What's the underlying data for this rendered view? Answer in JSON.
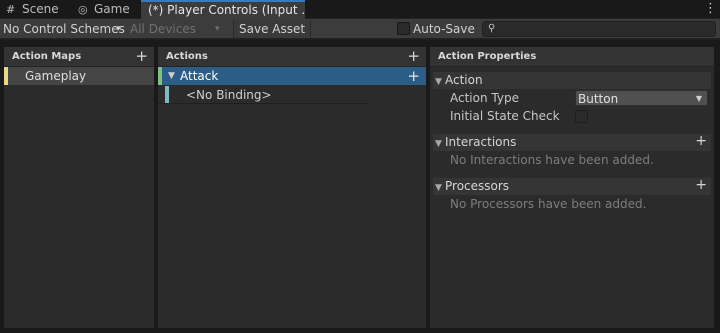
{
  "tabs": [
    {
      "icon": "grid-icon",
      "icon_glyph": "#",
      "label": "Scene"
    },
    {
      "icon": "gamepad-icon",
      "icon_glyph": "◎",
      "label": "Game"
    },
    {
      "icon": "",
      "icon_glyph": "",
      "label": "(*) Player Controls (Input ..."
    }
  ],
  "window_menu_glyph": "⋮",
  "toolbar": {
    "control_schemes_label": "No Control Schemes",
    "devices_label": "All Devices",
    "save_asset_label": "Save Asset",
    "auto_save_label": "Auto-Save",
    "auto_save_checked": false,
    "search_value": "",
    "dropdown_arrow": "▾"
  },
  "action_maps": {
    "title": "Action Maps",
    "add_glyph": "+",
    "items": [
      {
        "label": "Gameplay",
        "selected": true
      }
    ]
  },
  "actions": {
    "title": "Actions",
    "add_glyph": "+",
    "items": [
      {
        "label": "Attack",
        "expanded": true,
        "selected": true,
        "add_glyph": "+"
      }
    ],
    "bindings": [
      {
        "label": "<No Binding>"
      }
    ]
  },
  "action_properties": {
    "title": "Action Properties",
    "action_section": {
      "label": "Action",
      "fields": [
        {
          "label": "Action Type",
          "value": "Button"
        },
        {
          "label": "Initial State Check",
          "checked": false
        }
      ]
    },
    "interactions_section": {
      "label": "Interactions",
      "empty_text": "No Interactions have been added.",
      "add_glyph": "+"
    },
    "processors_section": {
      "label": "Processors",
      "empty_text": "No Processors have been added.",
      "add_glyph": "+"
    }
  },
  "colors": {
    "selection": "#2c5d87",
    "action_map_stripe": "#e8d98a",
    "action_stripe": "#7ec27b",
    "binding_stripe": "#7fb8c7",
    "tab_accent": "#3a79bb"
  }
}
